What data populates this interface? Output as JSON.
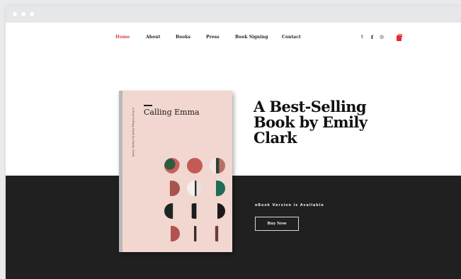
{
  "nav": {
    "items": [
      {
        "label": "Home",
        "active": true
      },
      {
        "label": "About",
        "active": false
      },
      {
        "label": "Books",
        "active": false
      },
      {
        "label": "Press",
        "active": false
      },
      {
        "label": "Book Signing",
        "active": false
      },
      {
        "label": "Contact",
        "active": false
      }
    ],
    "social": [
      {
        "icon": "twitter-icon",
        "glyph": "𝕥"
      },
      {
        "icon": "facebook-icon",
        "glyph": "f"
      },
      {
        "icon": "instagram-icon",
        "glyph": "◎"
      }
    ],
    "cart_icon": "shopping-bag-icon"
  },
  "book": {
    "title": "Calling Emma",
    "spine_text": "A Best-Selling Book by Emily Clark"
  },
  "hero": {
    "headline": "A Best-Selling Book by Emily Clark",
    "ebook_note": "eBook Version is Available",
    "buy_label": "Buy Now"
  },
  "colors": {
    "accent": "#e03d3d",
    "dark_band": "#202020",
    "cover": "#f2d6d0"
  }
}
